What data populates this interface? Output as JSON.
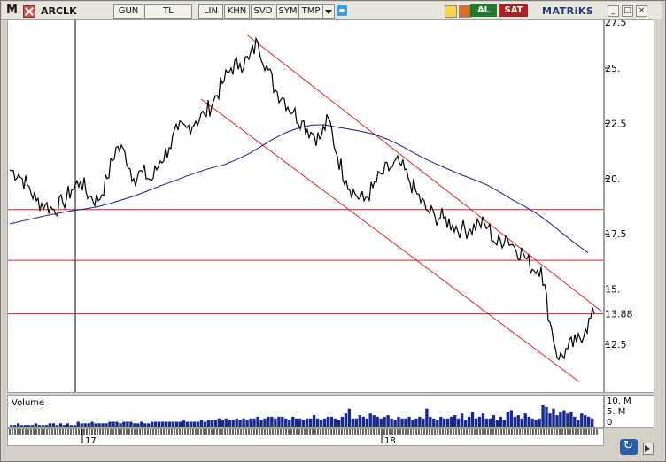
{
  "toolbar": {
    "m_label": "M",
    "symbol": "ARCLK",
    "buttons": [
      "GUN",
      "TL",
      "LIN",
      "KHN",
      "SVD",
      "SYM",
      "TMP"
    ],
    "al_label": "AL",
    "sat_label": "SAT",
    "brand": "MATRiKS",
    "window_buttons": [
      "_",
      "□",
      "×"
    ]
  },
  "colors": {
    "price": "#000000",
    "ma": "#1a1a8c",
    "lines": "#e02020",
    "volume": "#1a2a8c",
    "vertical_marker": "#000000"
  },
  "icons": [
    "close-icon",
    "dropdown-arrow-icon",
    "twitter-icon",
    "bolt-icon",
    "refresh-icon",
    "sync-icon",
    "scroll-right-icon"
  ],
  "chart_data": {
    "type": "line",
    "title": "",
    "ylim": [
      10.5,
      27
    ],
    "y_ticks": [
      "25.",
      "22.5",
      "20.",
      "17.5",
      "15.",
      "12.5"
    ],
    "y_top_partial": "27.5",
    "last_price_label": "13.88",
    "x_labels": [
      "17",
      "18"
    ],
    "x": [
      0,
      10,
      20,
      30,
      40,
      50,
      60,
      70,
      80,
      90,
      100,
      110,
      120,
      130,
      140,
      150,
      160,
      170,
      180,
      190,
      200,
      210,
      220,
      230,
      240,
      250,
      260,
      270,
      280,
      290,
      300,
      310,
      320,
      330,
      340,
      350,
      360,
      370,
      380,
      390,
      400,
      410,
      420,
      430,
      440,
      450,
      460,
      470,
      480,
      490,
      500,
      510,
      520,
      530,
      540,
      550,
      560,
      570,
      580,
      590,
      600,
      610,
      620,
      630,
      640,
      650,
      660
    ],
    "series": [
      {
        "values": [
          20.4,
          20.2,
          19.7,
          19.0,
          18.8,
          18.6,
          18.9,
          19.5,
          19.9,
          19.2,
          19.0,
          20.0,
          21.4,
          21.2,
          20.0,
          20.3,
          19.9,
          20.8,
          21.4,
          22.2,
          22.3,
          22.6,
          22.9,
          23.5,
          24.3,
          25.0,
          25.2,
          25.4,
          26.2,
          25.1,
          24.0,
          23.6,
          23.0,
          22.6,
          22.1,
          21.8,
          22.7,
          21.0,
          19.9,
          19.3,
          19.0,
          19.6,
          20.2,
          20.5,
          20.7,
          20.0,
          19.3,
          18.6,
          18.3,
          18.2,
          17.9,
          17.7,
          17.7,
          18.0,
          17.8,
          17.0,
          17.4,
          16.9,
          16.6,
          15.9,
          16.0,
          13.5,
          11.8,
          12.3,
          12.6,
          13.2,
          13.88
        ]
      },
      {
        "values": [
          17.95,
          18.08,
          18.21,
          18.34,
          18.45,
          18.55,
          18.63,
          18.73,
          18.88,
          19.05,
          19.23,
          19.45,
          19.68,
          19.88,
          20.1,
          20.3,
          20.48,
          20.62,
          20.85,
          21.12,
          21.46,
          21.81,
          22.09,
          22.3,
          22.42,
          22.44,
          22.33,
          22.24,
          22.13,
          22.0,
          21.79,
          21.52,
          21.2,
          20.9,
          20.64,
          20.39,
          20.15,
          19.94,
          19.7,
          19.38,
          19.03,
          18.72,
          18.38,
          17.96,
          17.5,
          17.05,
          16.64
        ]
      }
    ],
    "overlay_lines": [
      "horizontal at 18.6",
      "horizontal at 16.3",
      "horizontal at 13.88",
      "upper channel line",
      "lower channel line"
    ],
    "volume": {
      "label": "Volume",
      "y_ticks": [
        "10. M",
        "5. M",
        "0"
      ],
      "values": [
        1,
        1,
        2,
        1,
        1,
        1,
        1,
        2,
        1,
        1,
        1,
        2,
        2,
        1,
        2,
        1,
        2,
        1,
        1,
        3,
        2,
        2,
        2,
        3,
        2,
        2,
        2,
        2,
        3,
        3,
        3,
        2,
        3,
        3,
        3,
        2,
        2,
        3,
        2,
        2,
        3,
        3,
        3,
        3,
        3,
        3,
        3,
        3,
        3,
        4,
        3,
        3,
        3,
        3,
        4,
        3,
        4,
        4,
        4,
        5,
        4,
        5,
        4,
        4,
        5,
        4,
        5,
        4,
        5,
        5,
        6,
        4,
        5,
        6,
        6,
        5,
        6,
        6,
        5,
        4,
        6,
        5,
        5,
        4,
        5,
        5,
        7,
        5,
        4,
        5,
        6,
        6,
        5,
        4,
        6,
        8,
        11,
        5,
        5,
        7,
        6,
        5,
        8,
        7,
        6,
        5,
        6,
        7,
        5,
        4,
        6,
        5,
        5,
        6,
        4,
        5,
        6,
        5,
        11,
        6,
        5,
        4,
        6,
        5,
        5,
        6,
        7,
        5,
        8,
        4,
        6,
        9,
        5,
        6,
        8,
        5,
        5,
        7,
        4,
        6,
        4,
        9,
        10,
        6,
        7,
        5,
        8,
        6,
        5,
        4,
        5,
        13,
        12,
        8,
        11,
        7,
        9,
        10,
        8,
        9,
        6,
        4,
        8,
        7,
        6,
        5
      ]
    }
  }
}
